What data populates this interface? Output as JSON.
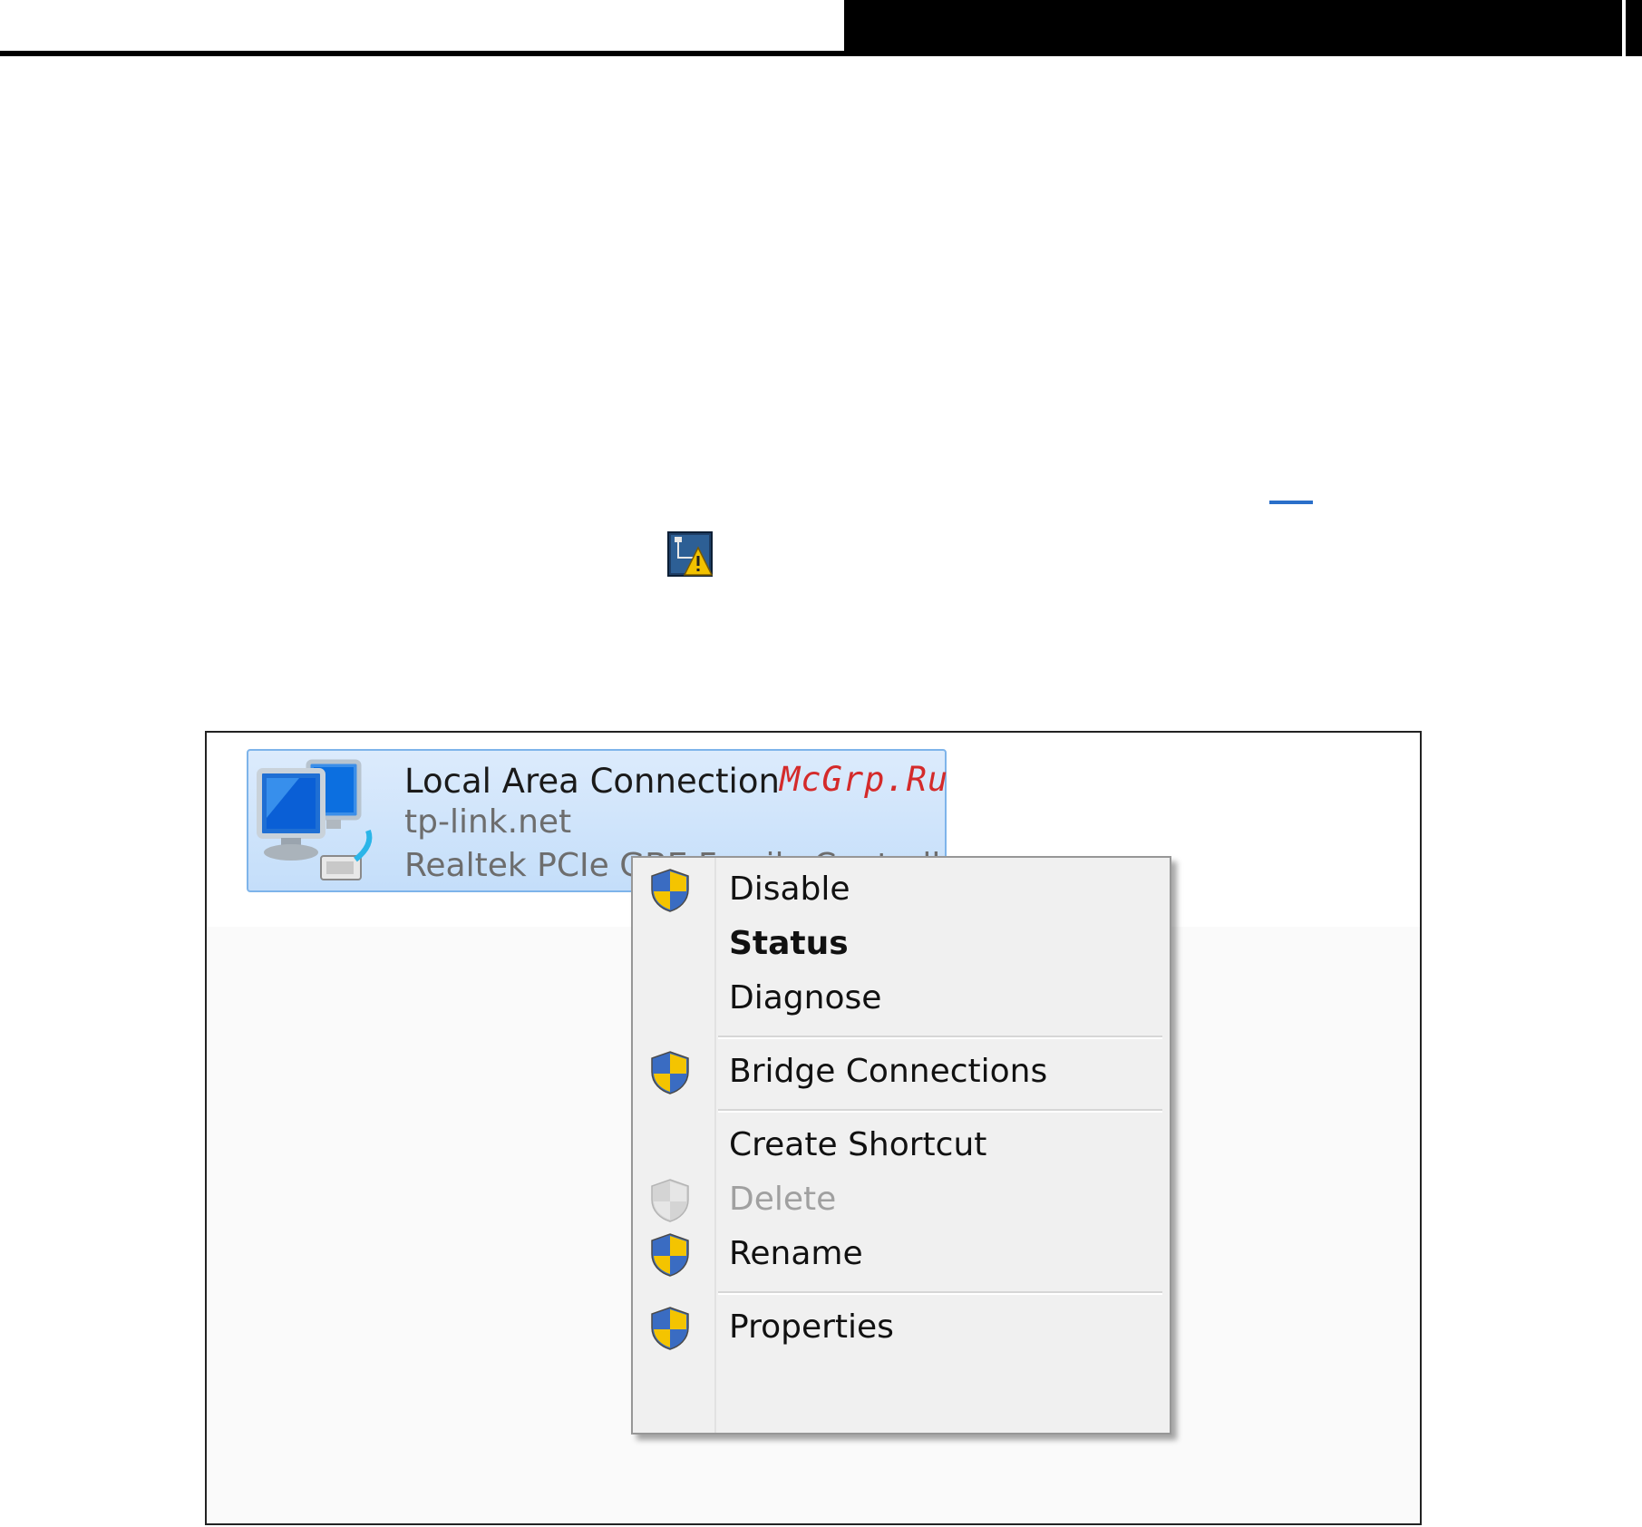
{
  "page": {
    "accent_color": "#2a6fc9"
  },
  "connection": {
    "name": "Local Area Connection",
    "network": "tp-link.net",
    "device": "Realtek PCIe GBE Family Controller",
    "icon": "network-computers-icon"
  },
  "watermark": "McGrp.Ru",
  "tray_icon": "network-warning-icon",
  "context_menu": {
    "items": [
      {
        "label": "Disable",
        "shield": true,
        "style": "normal"
      },
      {
        "label": "Status",
        "shield": false,
        "style": "bold"
      },
      {
        "label": "Diagnose",
        "shield": false,
        "style": "normal"
      },
      {
        "label": "Bridge Connections",
        "shield": true,
        "style": "normal"
      },
      {
        "label": "Create Shortcut",
        "shield": false,
        "style": "normal"
      },
      {
        "label": "Delete",
        "shield": true,
        "style": "disabled"
      },
      {
        "label": "Rename",
        "shield": true,
        "style": "normal"
      },
      {
        "label": "Properties",
        "shield": true,
        "style": "normal"
      }
    ]
  }
}
